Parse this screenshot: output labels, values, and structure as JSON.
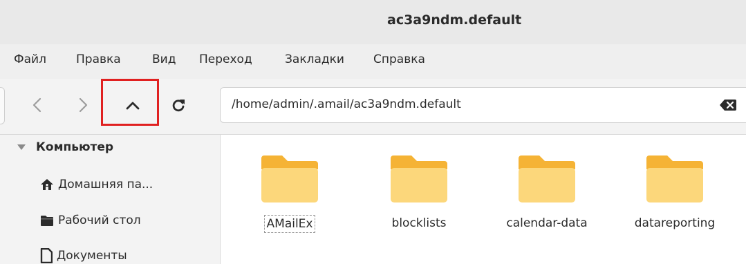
{
  "window": {
    "title": "ac3a9ndm.default"
  },
  "menu": [
    "Файл",
    "Правка",
    "Вид",
    "Переход",
    "Закладки",
    "Справка"
  ],
  "toolbar": {
    "back_icon": "chevron-left-icon",
    "forward_icon": "chevron-right-icon",
    "up_icon": "chevron-up-icon",
    "reload_icon": "reload-icon",
    "location": "/home/admin/.amail/ac3a9ndm.default",
    "clear_icon": "backspace-icon",
    "highlight_color": "#e02020"
  },
  "sidebar": {
    "header": "Компьютер",
    "items": [
      {
        "label": "Домашняя па...",
        "icon": "home-icon"
      },
      {
        "label": "Рабочий стол",
        "icon": "folder-icon"
      },
      {
        "label": "Документы",
        "icon": "document-icon"
      }
    ]
  },
  "files": [
    {
      "name": "AMailEx"
    },
    {
      "name": "blocklists"
    },
    {
      "name": "calendar-data"
    },
    {
      "name": "datareporting"
    }
  ],
  "colors": {
    "folder_back": "#f5b335",
    "folder_front": "#fcd77b"
  }
}
